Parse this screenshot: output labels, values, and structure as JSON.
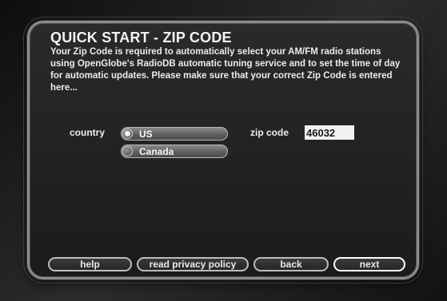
{
  "page": {
    "title": "QUICK START - ZIP CODE",
    "description": "Your Zip Code is required to automatically select your AM/FM radio stations using OpenGlobe's RadioDB automatic tuning service and to set the time of day for automatic updates. Please make sure that your correct Zip Code is entered here..."
  },
  "form": {
    "country_label": "country",
    "country_options": [
      {
        "label": "US",
        "selected": true
      },
      {
        "label": "Canada",
        "selected": false
      }
    ],
    "zip_label": "zip code",
    "zip_value": "46032"
  },
  "buttons": {
    "help": "help",
    "privacy": "read privacy policy",
    "back": "back",
    "next": "next"
  }
}
